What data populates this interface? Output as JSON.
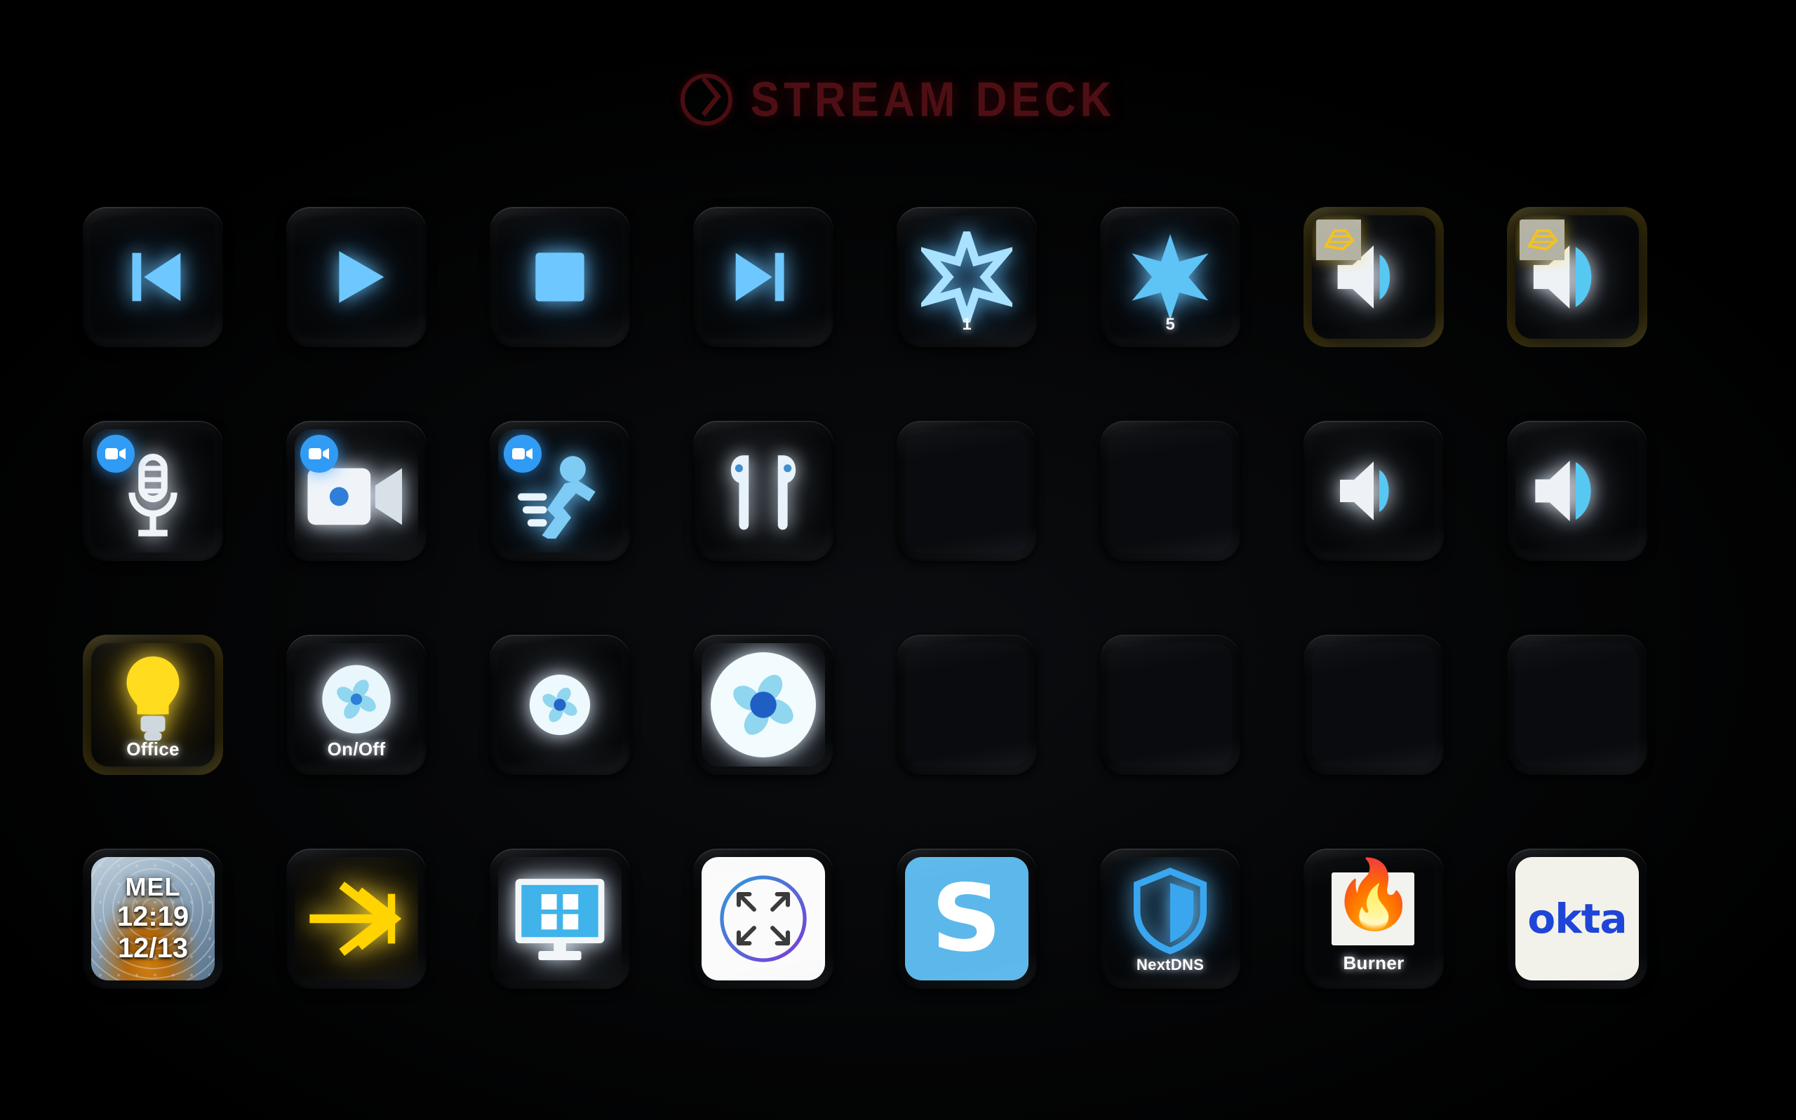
{
  "device": {
    "brand": "STREAM DECK",
    "logo_icon": "elgato-logo-icon",
    "brand_color": "#4e0f14",
    "model_layout": {
      "rows": 4,
      "columns": 8,
      "total_keys": 32
    }
  },
  "colors": {
    "key_blue": "#6ec8ff",
    "key_white": "#f0f4f8",
    "key_yellow": "#ffdc1e",
    "zoom_blue": "#2f9bf5",
    "okta_blue": "#1f45d8",
    "snagit_blue": "#5cb8ea",
    "nextdns_blue": "#3aa6f0",
    "background": "#000000"
  },
  "keys": [
    {
      "row": 1,
      "col": 1,
      "name": "previous-track",
      "icon": "previous-track-icon",
      "label": "",
      "state": "on"
    },
    {
      "row": 1,
      "col": 2,
      "name": "play",
      "icon": "play-icon",
      "label": "",
      "state": "on"
    },
    {
      "row": 1,
      "col": 3,
      "name": "stop",
      "icon": "stop-icon",
      "label": "",
      "state": "on"
    },
    {
      "row": 1,
      "col": 4,
      "name": "next-track",
      "icon": "next-track-icon",
      "label": "",
      "state": "on"
    },
    {
      "row": 1,
      "col": 5,
      "name": "scene-star-outline",
      "icon": "star-outline-icon",
      "label": "1",
      "state": "on"
    },
    {
      "row": 1,
      "col": 6,
      "name": "scene-star-filled",
      "icon": "star-filled-icon",
      "label": "5",
      "state": "on"
    },
    {
      "row": 1,
      "col": 7,
      "name": "app-volume-down",
      "icon": "speaker-low-icon",
      "label": "",
      "badge": "app-badge-yellow",
      "state": "on"
    },
    {
      "row": 1,
      "col": 8,
      "name": "app-volume-up",
      "icon": "speaker-high-icon",
      "label": "",
      "badge": "app-badge-yellow",
      "state": "on"
    },
    {
      "row": 2,
      "col": 1,
      "name": "zoom-mute-microphone",
      "icon": "microphone-icon",
      "label": "",
      "badge": "zoom-camera-badge",
      "state": "on"
    },
    {
      "row": 2,
      "col": 2,
      "name": "zoom-toggle-video",
      "icon": "video-camera-icon",
      "label": "",
      "badge": "zoom-camera-badge",
      "state": "on"
    },
    {
      "row": 2,
      "col": 3,
      "name": "zoom-leave-meeting",
      "icon": "running-person-icon",
      "label": "",
      "badge": "zoom-camera-badge",
      "state": "on"
    },
    {
      "row": 2,
      "col": 4,
      "name": "airpods-connect",
      "icon": "airpods-icon",
      "label": "",
      "state": "on"
    },
    {
      "row": 2,
      "col": 5,
      "name": "empty-key",
      "icon": "",
      "label": "",
      "state": "off"
    },
    {
      "row": 2,
      "col": 6,
      "name": "empty-key",
      "icon": "",
      "label": "",
      "state": "off"
    },
    {
      "row": 2,
      "col": 7,
      "name": "system-volume-down",
      "icon": "speaker-low-icon",
      "label": "",
      "state": "on"
    },
    {
      "row": 2,
      "col": 8,
      "name": "system-volume-up",
      "icon": "speaker-high-icon",
      "label": "",
      "state": "on"
    },
    {
      "row": 3,
      "col": 1,
      "name": "office-light",
      "icon": "lightbulb-icon",
      "label": "Office",
      "state": "on"
    },
    {
      "row": 3,
      "col": 2,
      "name": "fan-power-toggle",
      "icon": "fan-icon",
      "label": "On/Off",
      "state": "on"
    },
    {
      "row": 3,
      "col": 3,
      "name": "fan-speed-down",
      "icon": "fan-small-icon",
      "label": "",
      "state": "on"
    },
    {
      "row": 3,
      "col": 4,
      "name": "fan-speed-up",
      "icon": "fan-large-icon",
      "label": "",
      "state": "on"
    },
    {
      "row": 3,
      "col": 5,
      "name": "empty-key",
      "icon": "",
      "label": "",
      "state": "off"
    },
    {
      "row": 3,
      "col": 6,
      "name": "empty-key",
      "icon": "",
      "label": "",
      "state": "off"
    },
    {
      "row": 3,
      "col": 7,
      "name": "empty-key",
      "icon": "",
      "label": "",
      "state": "off"
    },
    {
      "row": 3,
      "col": 8,
      "name": "empty-key",
      "icon": "",
      "label": "",
      "state": "off"
    },
    {
      "row": 4,
      "col": 1,
      "name": "world-clock-melbourne",
      "icon": "world-clock-icon",
      "label": "",
      "state": "on",
      "clock": {
        "city": "MEL",
        "time": "12:19",
        "date": "12/13"
      }
    },
    {
      "row": 4,
      "col": 2,
      "name": "flight-shortcut",
      "icon": "airplane-chevron-icon",
      "label": "",
      "state": "on"
    },
    {
      "row": 4,
      "col": 3,
      "name": "display-arrangement",
      "icon": "monitor-tile-icon",
      "label": "",
      "state": "on"
    },
    {
      "row": 4,
      "col": 4,
      "name": "rectangle-window-manager",
      "icon": "four-arrows-circle-icon",
      "label": "",
      "state": "on"
    },
    {
      "row": 4,
      "col": 5,
      "name": "snagit-capture",
      "icon": "snagit-s-icon",
      "label": "S",
      "state": "on"
    },
    {
      "row": 4,
      "col": 6,
      "name": "nextdns-toggle",
      "icon": "shield-icon",
      "label": "NextDNS",
      "state": "on"
    },
    {
      "row": 4,
      "col": 7,
      "name": "burner-toggle",
      "icon": "flame-icon",
      "label": "Burner",
      "state": "on"
    },
    {
      "row": 4,
      "col": 8,
      "name": "okta-verify",
      "icon": "okta-logo-icon",
      "label": "okta",
      "state": "on"
    }
  ]
}
